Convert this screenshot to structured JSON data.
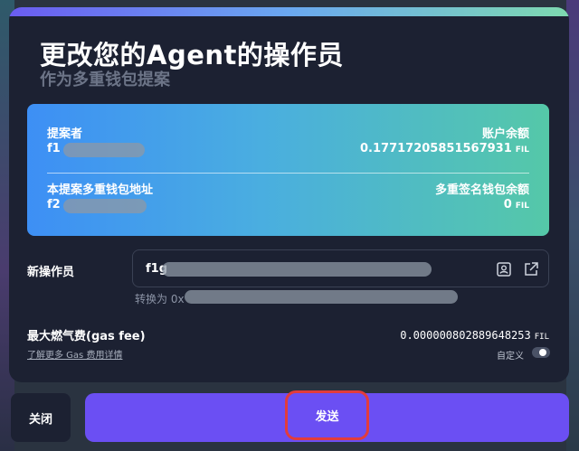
{
  "dialog": {
    "title": "更改您的Agent的操作员",
    "subtitle": "作为多重钱包提案"
  },
  "proposal_card": {
    "proposer_label": "提案者",
    "proposer_prefix": "f1",
    "balance_label": "账户余额",
    "balance_value": "0.17717205851567931",
    "balance_unit": "FIL",
    "multisig_address_label": "本提案多重钱包地址",
    "multisig_address_prefix": "f2",
    "multisig_balance_label": "多重签名钱包余额",
    "multisig_balance_value": "0",
    "multisig_balance_unit": "FIL"
  },
  "operator": {
    "label": "新操作员",
    "input_prefix": "f1g",
    "convert_prefix": "转换为 0x"
  },
  "gas": {
    "label": "最大燃气费(gas fee)",
    "link": "了解更多 Gas 费用详情",
    "value": "0.000000802889648253",
    "unit": "FIL",
    "custom_label": "自定义"
  },
  "buttons": {
    "close": "关闭",
    "send": "发送"
  },
  "colors": {
    "accent": "#6b4ff3",
    "highlight": "#e23c3c",
    "card_start": "#3d8ff5",
    "card_end": "#55c8a8"
  },
  "icons": [
    "address-book-icon",
    "external-link-icon"
  ]
}
